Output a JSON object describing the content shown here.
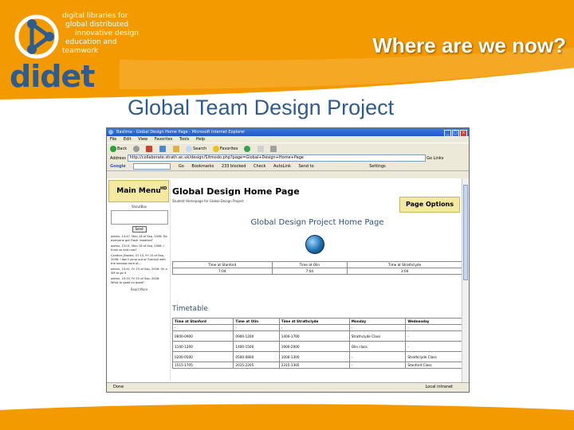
{
  "slide": {
    "logo_lines": [
      "digital libraries for",
      "global distributed",
      "innovative design",
      "education and",
      "teamwork"
    ],
    "logo_word": "didet",
    "title": "Where are we now?",
    "subtitle": "Global Team Design Project"
  },
  "browser": {
    "window_title": "Baslima - Global Design Home Page - Microsoft Internet Explorer",
    "menu": [
      "File",
      "Edit",
      "View",
      "Favorites",
      "Tools",
      "Help"
    ],
    "toolbar": [
      "Back",
      "Search",
      "Favorites"
    ],
    "address_label": "Address",
    "address_value": "http://collaborate.strath.ac.uk/design/Sitmodo.php?page=Global+Design+Home+Page",
    "go_label": "Go",
    "links_label": "Links",
    "google": {
      "label": "Google",
      "go": "Go",
      "bookmarks": "Bookmarks",
      "blocked": "233 blocked",
      "check": "Check",
      "autolink": "AutoLink",
      "send_to": "Send to",
      "settings": "Settings"
    },
    "status_left": "Done",
    "status_right": "Local intranet"
  },
  "page": {
    "main_menu": "Main Menu",
    "hd_badge": "HD",
    "page_head": "Global Design Home Page",
    "page_sub": "Student Homepage for Global Design Project",
    "page_options": "Page Options",
    "chat_title": "ShoutBox",
    "send_label": "Send",
    "messages": [
      "admin, 14:47, Mon 18 of Sep, 2006: Do everyone got Flash installed?",
      "admin, 15:01, Mon 18 of Sep, 2006: I think so and now?",
      "Candice_Brooks, 07:10, Fri 15 of Sep, 2006: I don't jump out of Turnbull with the window here at...",
      "admin, 23:41, Fri 15 of Sep, 2006: Ok a SM to go it",
      "admin, 10:20, Fri 15 of Sep, 2006: What to good on good?"
    ],
    "read_more": "Read More",
    "inner_title": "Global Design Project Home Page",
    "time_headers": [
      "Time at Stanford",
      "Time at Olin",
      "Time at Strathclyde"
    ],
    "time_values": [
      "7:04",
      "7:04",
      "3:04"
    ],
    "timetable_title": "Timetable",
    "sched_headers": [
      "Time at Stanford",
      "Time at Olin",
      "Time at Strathclyde",
      "Monday",
      "Wednesday"
    ],
    "sched_rows": [
      [
        "-",
        "-",
        "-",
        "-",
        "-"
      ],
      [
        "0600-0900",
        "0900-1200",
        "1400-1700",
        "Strathclyde Class",
        "-"
      ],
      [
        "1100-1200",
        "1400-1500",
        "1900-2000",
        "Olin class",
        "-"
      ],
      [
        "0200-0500",
        "0500-0800",
        "1000-1300",
        "-",
        "Strathclyde Class"
      ],
      [
        "1515-1705",
        "2015-2205",
        "2315-1305",
        "-",
        "Stanford Class"
      ]
    ],
    "row_heights": [
      "short",
      "tall",
      "tall",
      "tall",
      "short"
    ]
  },
  "colors": {
    "orange": "#f39a00",
    "blue": "#2f5c8f"
  }
}
